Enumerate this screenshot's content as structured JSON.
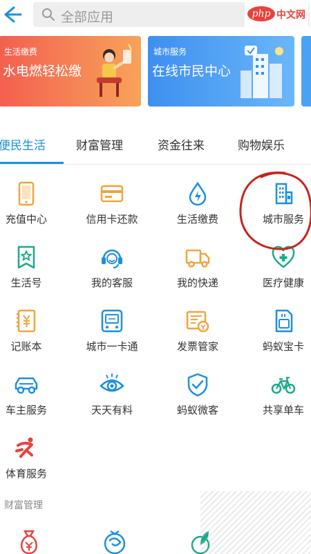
{
  "search": {
    "placeholder": "全部应用"
  },
  "watermark": {
    "brand": "php",
    "text": "中文网"
  },
  "banners": [
    {
      "small": "生活缴费",
      "big": "水电燃轻松缴"
    },
    {
      "small": "城市服务",
      "big": "在线市民中心"
    }
  ],
  "tabs": [
    {
      "label": "便民生活",
      "active": true
    },
    {
      "label": "财富管理",
      "active": false
    },
    {
      "label": "资金往来",
      "active": false
    },
    {
      "label": "购物娱乐",
      "active": false
    }
  ],
  "grid": [
    {
      "label": "充值中心",
      "icon": "phone-icon",
      "color": "#f3a33a"
    },
    {
      "label": "信用卡还款",
      "icon": "credit-card-icon",
      "color": "#f3a33a"
    },
    {
      "label": "生活缴费",
      "icon": "water-drop-icon",
      "color": "#1a8fe3"
    },
    {
      "label": "城市服务",
      "icon": "building-icon",
      "color": "#1a8fe3"
    },
    {
      "label": "生活号",
      "icon": "badge-star-icon",
      "color": "#1aa98b"
    },
    {
      "label": "我的客服",
      "icon": "headset-icon",
      "color": "#1a8fe3"
    },
    {
      "label": "我的快递",
      "icon": "truck-icon",
      "color": "#f3a33a"
    },
    {
      "label": "医疗健康",
      "icon": "heart-medical-icon",
      "color": "#1aa98b"
    },
    {
      "label": "记账本",
      "icon": "ledger-icon",
      "color": "#f3a33a"
    },
    {
      "label": "城市一卡通",
      "icon": "transit-card-icon",
      "color": "#1a8fe3"
    },
    {
      "label": "发票管家",
      "icon": "invoice-icon",
      "color": "#f3a33a"
    },
    {
      "label": "蚂蚁宝卡",
      "icon": "sim-card-icon",
      "color": "#1a8fe3"
    },
    {
      "label": "车主服务",
      "icon": "car-icon",
      "color": "#1a8fe3"
    },
    {
      "label": "天天有料",
      "icon": "eye-radar-icon",
      "color": "#1a8fe3"
    },
    {
      "label": "蚂蚁微客",
      "icon": "shield-check-icon",
      "color": "#1a8fe3"
    },
    {
      "label": "共享单车",
      "icon": "bicycle-icon",
      "color": "#1aa98b"
    },
    {
      "label": "体育服务",
      "icon": "runner-icon",
      "color": "#e9413b"
    }
  ],
  "section": {
    "title": "财富管理"
  },
  "colors": {
    "accent": "#1a8fe3",
    "highlight_circle": "#c8241c"
  }
}
